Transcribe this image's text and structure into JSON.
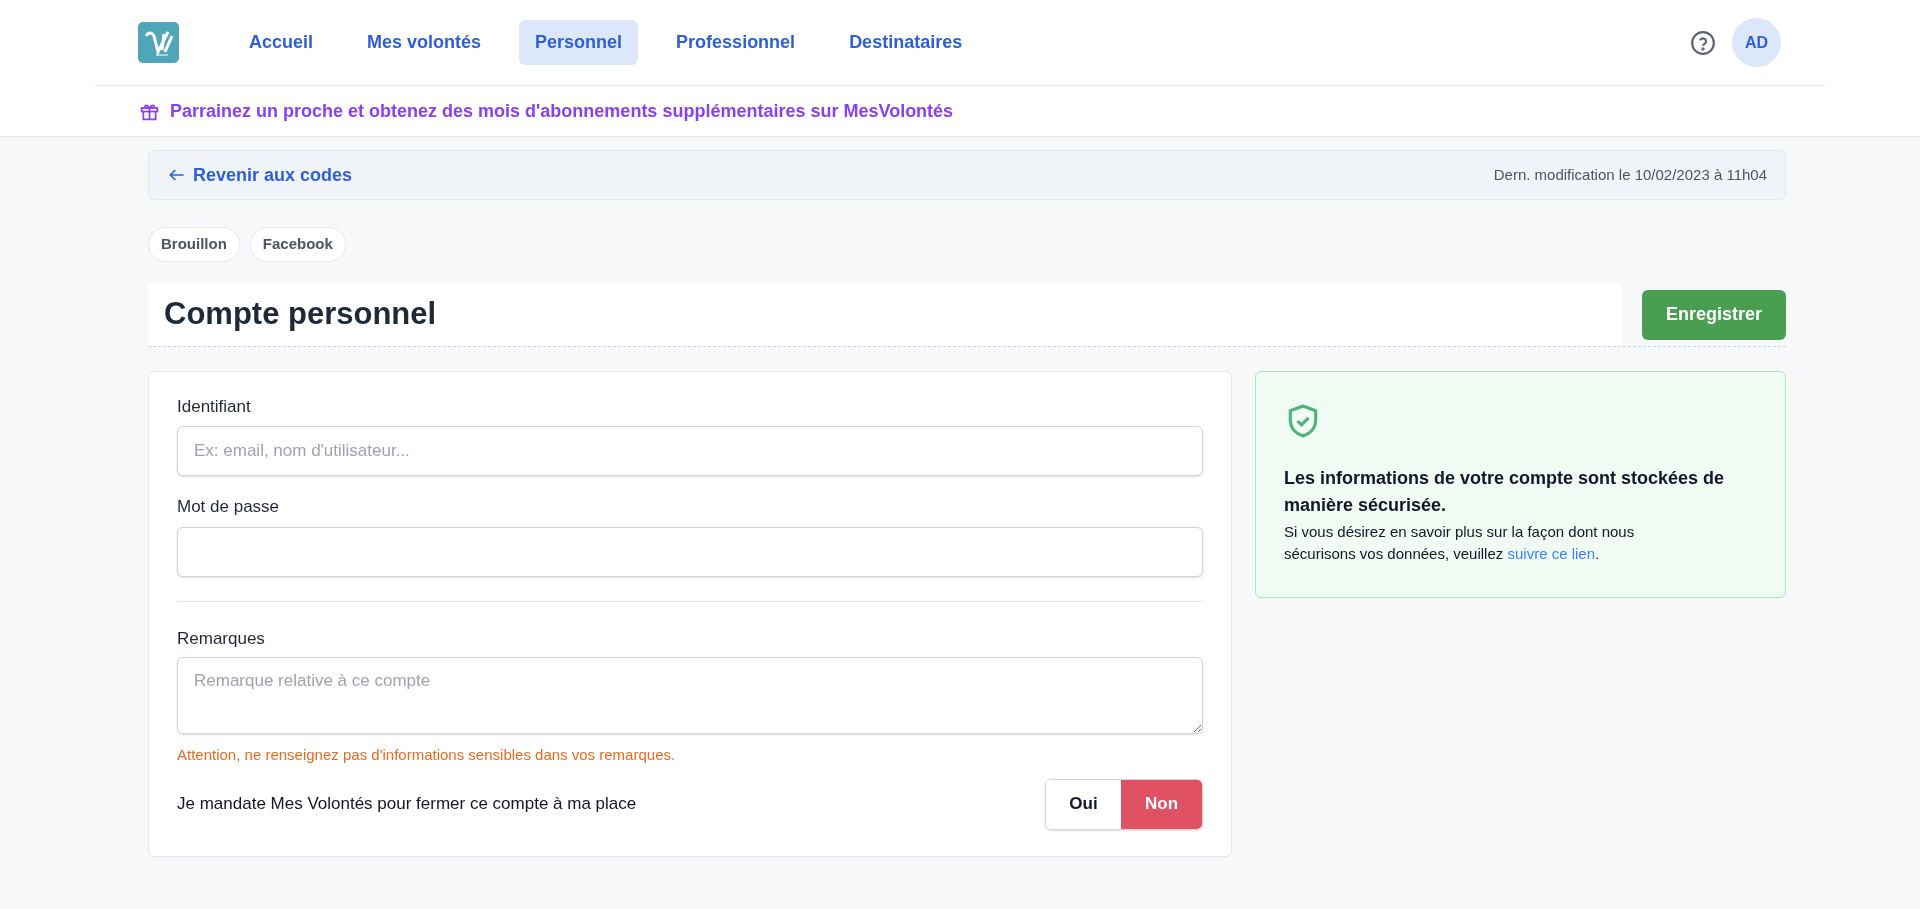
{
  "nav": {
    "tabs": [
      {
        "label": "Accueil",
        "selected": false
      },
      {
        "label": "Mes volontés",
        "selected": false
      },
      {
        "label": "Personnel",
        "selected": true
      },
      {
        "label": "Professionnel",
        "selected": false
      },
      {
        "label": "Destinataires",
        "selected": false
      }
    ],
    "avatar": "AD"
  },
  "promo": "Parrainez un proche et obtenez des mois d'abonnements supplémentaires sur MesVolontés",
  "back_link": "Revenir aux codes",
  "last_modified": "Dern. modification le 10/02/2023 à 11h04",
  "tags": [
    "Brouillon",
    "Facebook"
  ],
  "title": "Compte personnel",
  "save_button": "Enregistrer",
  "form": {
    "fields": [
      {
        "label": "Identifiant",
        "placeholder": "Ex: email, nom d'utilisateur..."
      },
      {
        "label": "Mot de passe"
      }
    ],
    "remarks": {
      "label": "Remarques",
      "placeholder": "Remarque relative à ce compte",
      "warning": "Attention, ne renseignez pas d'informations sensibles dans vos remarques."
    },
    "mandate": {
      "label": "Je mandate Mes Volontés pour fermer ce compte à ma place",
      "options": [
        {
          "label": "Oui",
          "selected": false
        },
        {
          "label": "Non",
          "selected": true
        }
      ]
    }
  },
  "info": {
    "heading": "Les informations de votre compte sont stockées de manière sécurisée.",
    "text": "Si vous désirez en savoir plus sur la façon dont nous sécurisons vos données, veuillez ",
    "link": "suivre ce lien",
    "text_end": "."
  }
}
